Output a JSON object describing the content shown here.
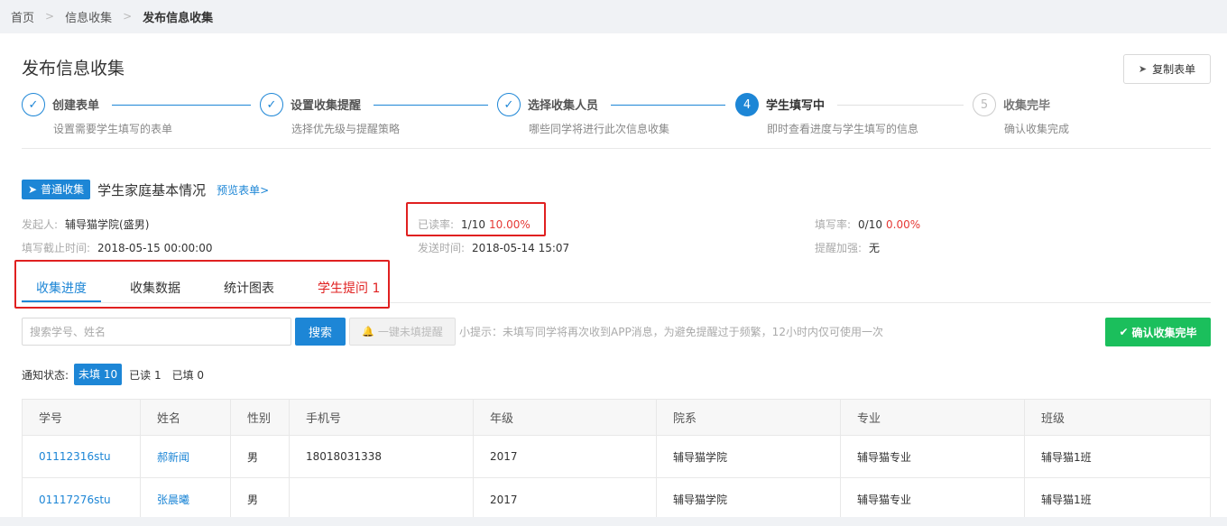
{
  "breadcrumb": {
    "items": [
      "首页",
      "信息收集",
      "发布信息收集"
    ]
  },
  "page": {
    "title": "发布信息收集",
    "copy_label": "复制表单"
  },
  "steps": [
    {
      "num": "✓",
      "title": "创建表单",
      "desc": "设置需要学生填写的表单",
      "state": "done"
    },
    {
      "num": "✓",
      "title": "设置收集提醒",
      "desc": "选择优先级与提醒策略",
      "state": "done"
    },
    {
      "num": "✓",
      "title": "选择收集人员",
      "desc": "哪些同学将进行此次信息收集",
      "state": "done"
    },
    {
      "num": "4",
      "title": "学生填写中",
      "desc": "即时查看进度与学生填写的信息",
      "state": "active"
    },
    {
      "num": "5",
      "title": "收集完毕",
      "desc": "确认收集完成",
      "state": "wait"
    }
  ],
  "form": {
    "tag": "普通收集",
    "name": "学生家庭基本情况",
    "preview": "预览表单>"
  },
  "meta": {
    "publisher_label": "发起人:",
    "publisher": "辅导猫学院(盛男)",
    "deadline_label": "填写截止时间:",
    "deadline": "2018-05-15 00:00:00",
    "read_label": "已读率:",
    "read_count": "1/10",
    "read_pct": "10.00%",
    "sent_label": "发送时间:",
    "sent": "2018-05-14 15:07",
    "fill_label": "填写率:",
    "fill_count": "0/10",
    "fill_pct": "0.00%",
    "boost_label": "提醒加强:",
    "boost": "无"
  },
  "tabs": [
    "收集进度",
    "收集数据",
    "统计图表",
    "学生提问 1"
  ],
  "toolbar": {
    "search_placeholder": "搜索学号、姓名",
    "search_label": "搜索",
    "remind_label": "一键未填提醒",
    "hint": "小提示：未填写同学将再次收到APP消息，为避免提醒过于频繁，12小时内仅可使用一次",
    "confirm_label": "确认收集完毕"
  },
  "status": {
    "label": "通知状态:",
    "unfilled": "未填 10",
    "read": "已读 1",
    "filled": "已填 0"
  },
  "table": {
    "headers": [
      "学号",
      "姓名",
      "性别",
      "手机号",
      "年级",
      "院系",
      "专业",
      "班级"
    ],
    "rows": [
      [
        "01112316stu",
        "郝新闻",
        "男",
        "18018031338",
        "2017",
        "辅导猫学院",
        "辅导猫专业",
        "辅导猫1班"
      ],
      [
        "01117276stu",
        "张晨曦",
        "男",
        "",
        "2017",
        "辅导猫学院",
        "辅导猫专业",
        "辅导猫1班"
      ]
    ]
  }
}
